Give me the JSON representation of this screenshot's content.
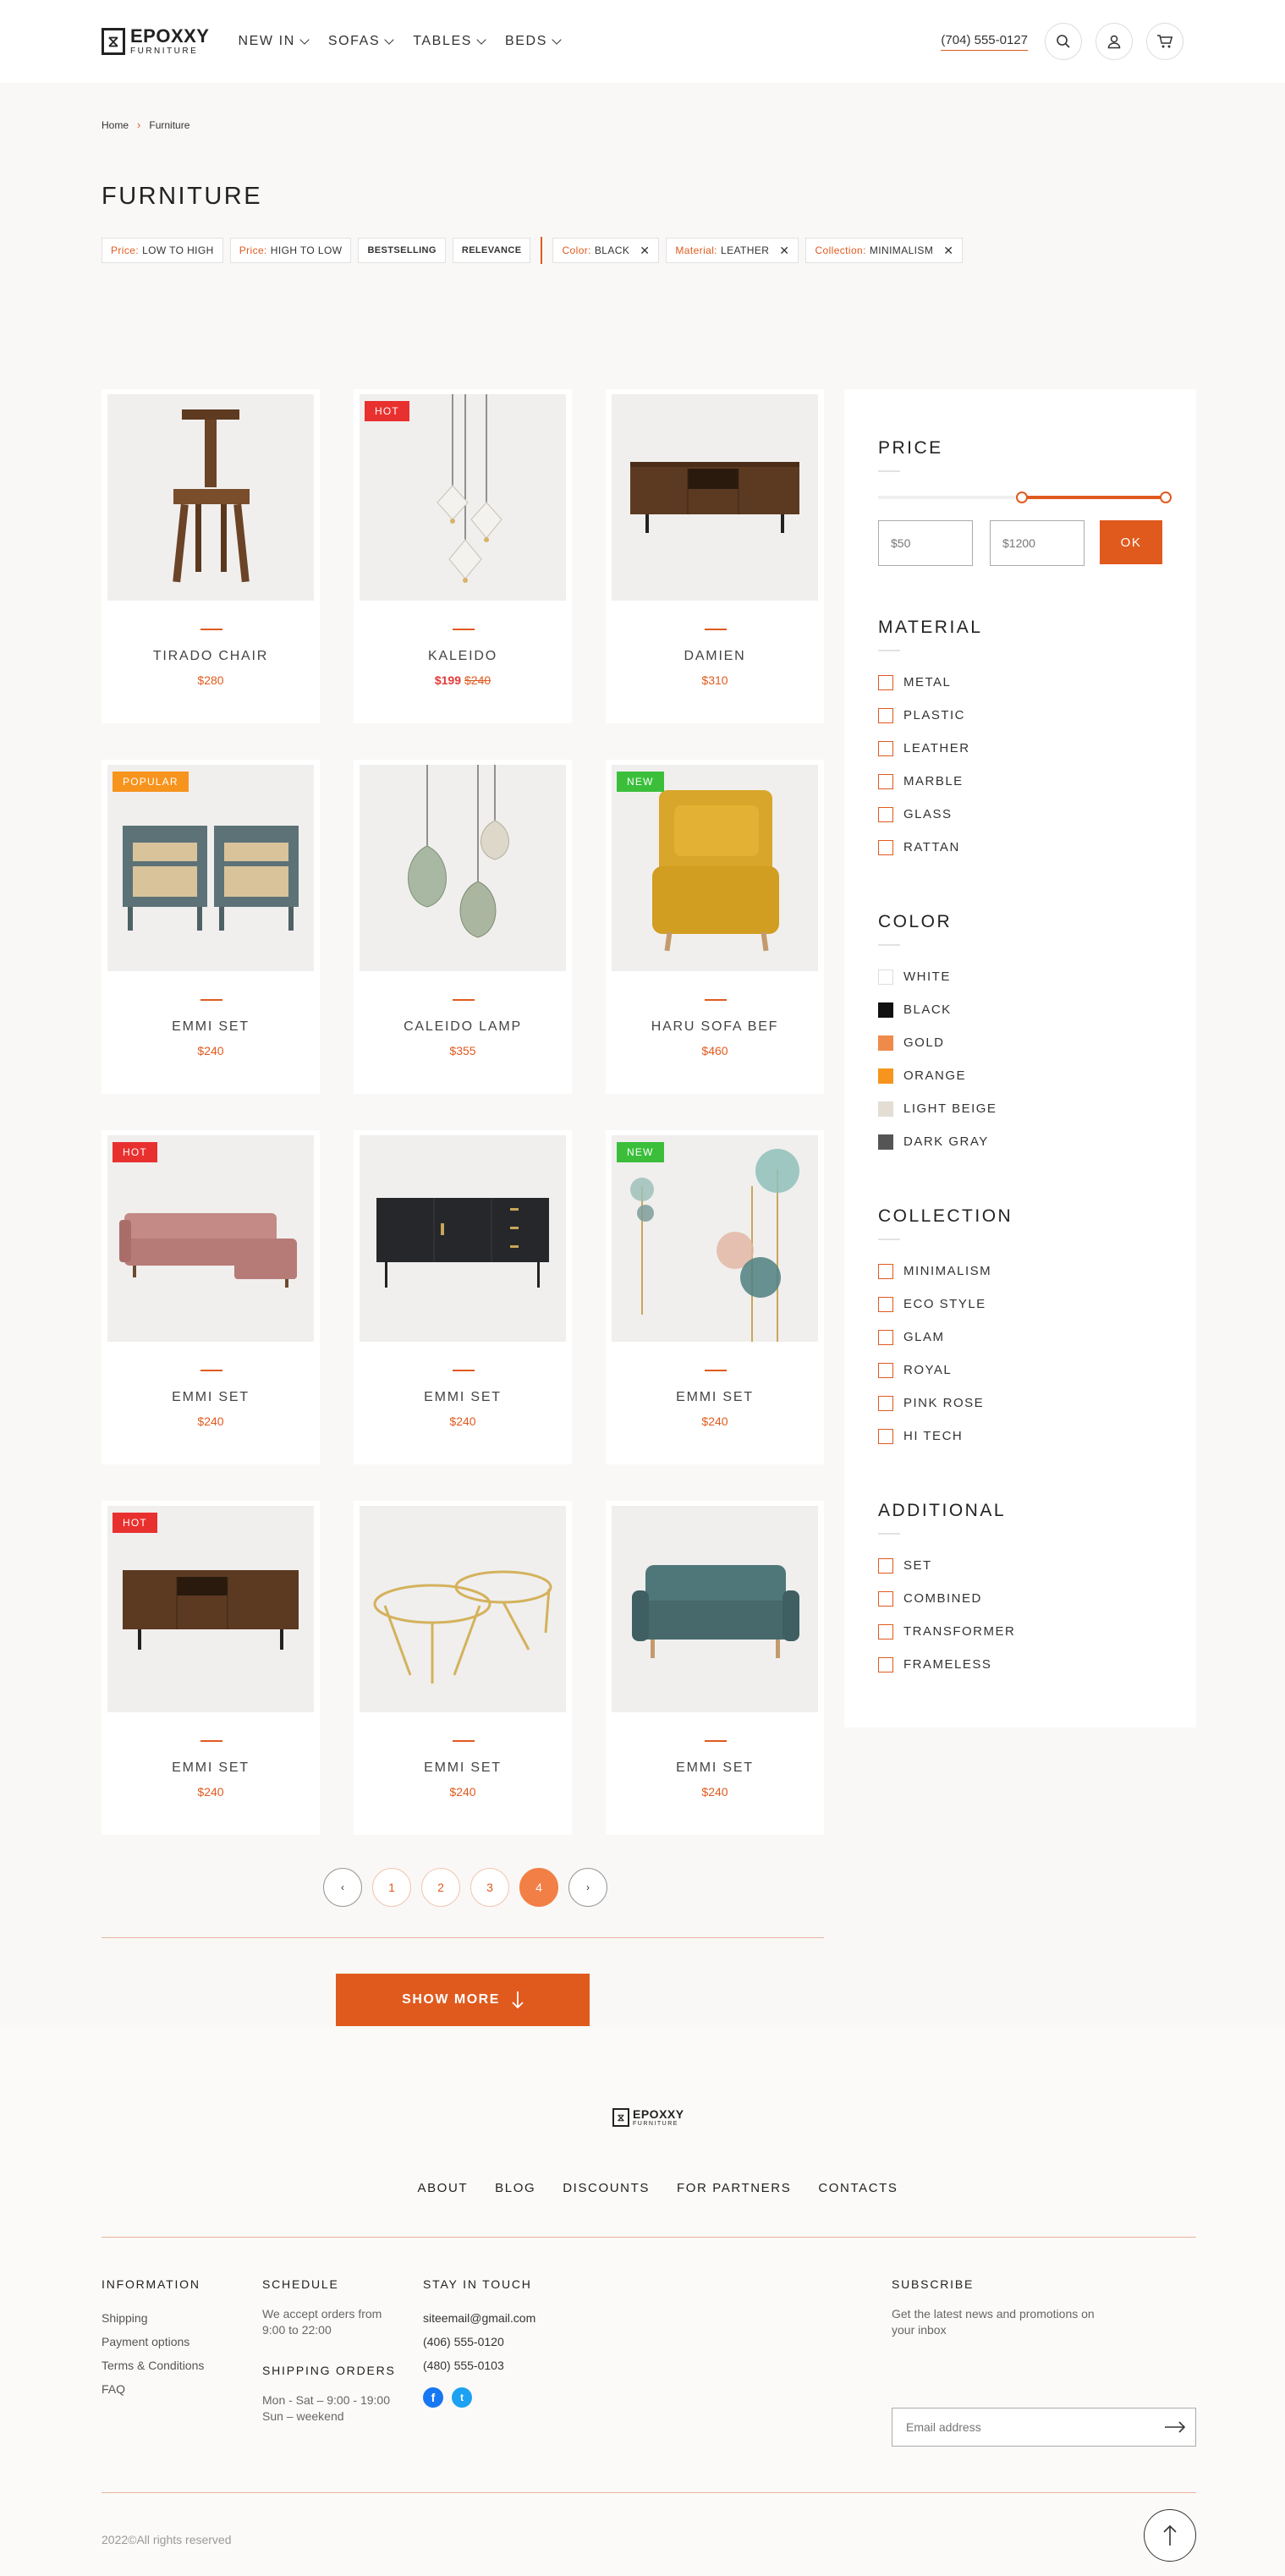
{
  "header": {
    "logo_name": "EPOXXY",
    "logo_sub": "FURNITURE",
    "nav": [
      "NEW IN",
      "SOFAS",
      "TABLES",
      "BEDS"
    ],
    "phone": "(704) 555-0127"
  },
  "breadcrumb": [
    "Home",
    "Furniture"
  ],
  "page_title": "FURNITURE",
  "filters": {
    "sort_chips": [
      {
        "key": "Price:",
        "value": "LOW TO HIGH"
      },
      {
        "key": "Price:",
        "value": "HIGH TO LOW"
      },
      {
        "key": "",
        "value": "BESTSELLING"
      },
      {
        "key": "",
        "value": "RELEVANCE"
      }
    ],
    "active_chips": [
      {
        "key": "Color:",
        "value": "BLACK"
      },
      {
        "key": "Material:",
        "value": "LEATHER"
      },
      {
        "key": "Collection:",
        "value": "MINIMALISM"
      }
    ],
    "remove_glyph": "✕"
  },
  "products": [
    {
      "name": "TIRADO CHAIR",
      "price": "$280",
      "old_price": "",
      "badge": "",
      "badge_color": ""
    },
    {
      "name": "KALEIDO",
      "price": "$199",
      "old_price": "$240",
      "badge": "HOT",
      "badge_color": "#e8312f"
    },
    {
      "name": "DAMIEN",
      "price": "$310",
      "old_price": "",
      "badge": "",
      "badge_color": ""
    },
    {
      "name": "EMMI SET",
      "price": "$240",
      "old_price": "",
      "badge": "POPULAR",
      "badge_color": "#f7941d"
    },
    {
      "name": "CALEIDO LAMP",
      "price": "$355",
      "old_price": "",
      "badge": "",
      "badge_color": ""
    },
    {
      "name": "HARU SOFA BEF",
      "price": "$460",
      "old_price": "",
      "badge": "NEW",
      "badge_color": "#3bbf3b"
    },
    {
      "name": "EMMI SET",
      "price": "$240",
      "old_price": "",
      "badge": "HOT",
      "badge_color": "#e8312f"
    },
    {
      "name": "EMMI SET",
      "price": "$240",
      "old_price": "",
      "badge": "",
      "badge_color": ""
    },
    {
      "name": "EMMI SET",
      "price": "$240",
      "old_price": "",
      "badge": "NEW",
      "badge_color": "#3bbf3b"
    },
    {
      "name": "EMMI SET",
      "price": "$240",
      "old_price": "",
      "badge": "HOT",
      "badge_color": "#e8312f"
    },
    {
      "name": "EMMI SET",
      "price": "$240",
      "old_price": "",
      "badge": "",
      "badge_color": ""
    },
    {
      "name": "EMMI SET",
      "price": "$240",
      "old_price": "",
      "badge": "",
      "badge_color": ""
    }
  ],
  "pagination": {
    "prev": "‹",
    "pages": [
      "1",
      "2",
      "3",
      "4"
    ],
    "active": "4",
    "next": "›"
  },
  "show_more": "SHOW MORE",
  "sidebar": {
    "price": {
      "title": "PRICE",
      "min_placeholder": "$50",
      "max_placeholder": "$1200",
      "separator": "-",
      "ok": "OK",
      "range_low": 0.5,
      "range_high": 1.0
    },
    "material": {
      "title": "MATERIAL",
      "options": [
        "METAL",
        "PLASTIC",
        "LEATHER",
        "MARBLE",
        "GLASS",
        "RATTAN"
      ]
    },
    "color": {
      "title": "COLOR",
      "options": [
        {
          "label": "WHITE",
          "swatch": "#ffffff"
        },
        {
          "label": "BLACK",
          "swatch": "#111111"
        },
        {
          "label": "GOLD",
          "swatch": "#f08a4b"
        },
        {
          "label": "ORANGE",
          "swatch": "#f7941d"
        },
        {
          "label": "LIGHT BEIGE",
          "swatch": "#e3ddd4"
        },
        {
          "label": "DARK GRAY",
          "swatch": "#555555"
        }
      ]
    },
    "collection": {
      "title": "COLLECTION",
      "options": [
        "MINIMALISM",
        "ECO STYLE",
        "GLAM",
        "ROYAL",
        "PINK ROSE",
        "HI TECH"
      ]
    },
    "additional": {
      "title": "ADDITIONAL",
      "options": [
        "SET",
        "COMBINED",
        "TRANSFORMER",
        "FRAMELESS"
      ]
    }
  },
  "footer": {
    "logo_name": "EPOXXY",
    "logo_sub": "FURNITURE",
    "nav": [
      "ABOUT",
      "BLOG",
      "DISCOUNTS",
      "FOR PARTNERS",
      "CONTACTS"
    ],
    "information": {
      "title": "INFORMATION",
      "links": [
        "Shipping",
        "Payment options",
        "Terms & Conditions",
        "FAQ"
      ]
    },
    "schedule": {
      "title": "SCHEDULE",
      "text": "We accept orders from 9:00 to 22:00",
      "shipping_title": "SHIPPING ORDERS",
      "shipping_text_1": "Mon - Sat – 9:00 - 19:00",
      "shipping_text_2": "Sun – weekend"
    },
    "stay_in_touch": {
      "title": "STAY IN TOUCH",
      "email": "siteemail@gmail.com",
      "phone_1": "(406) 555-0120",
      "phone_2": "(480) 555-0103"
    },
    "subscribe": {
      "title": "SUBSCRIBE",
      "text": "Get the latest news and promotions on your inbox",
      "placeholder": "Email address"
    },
    "copyright": "2022©All rights reserved"
  },
  "accent_color": "#e05a1e"
}
